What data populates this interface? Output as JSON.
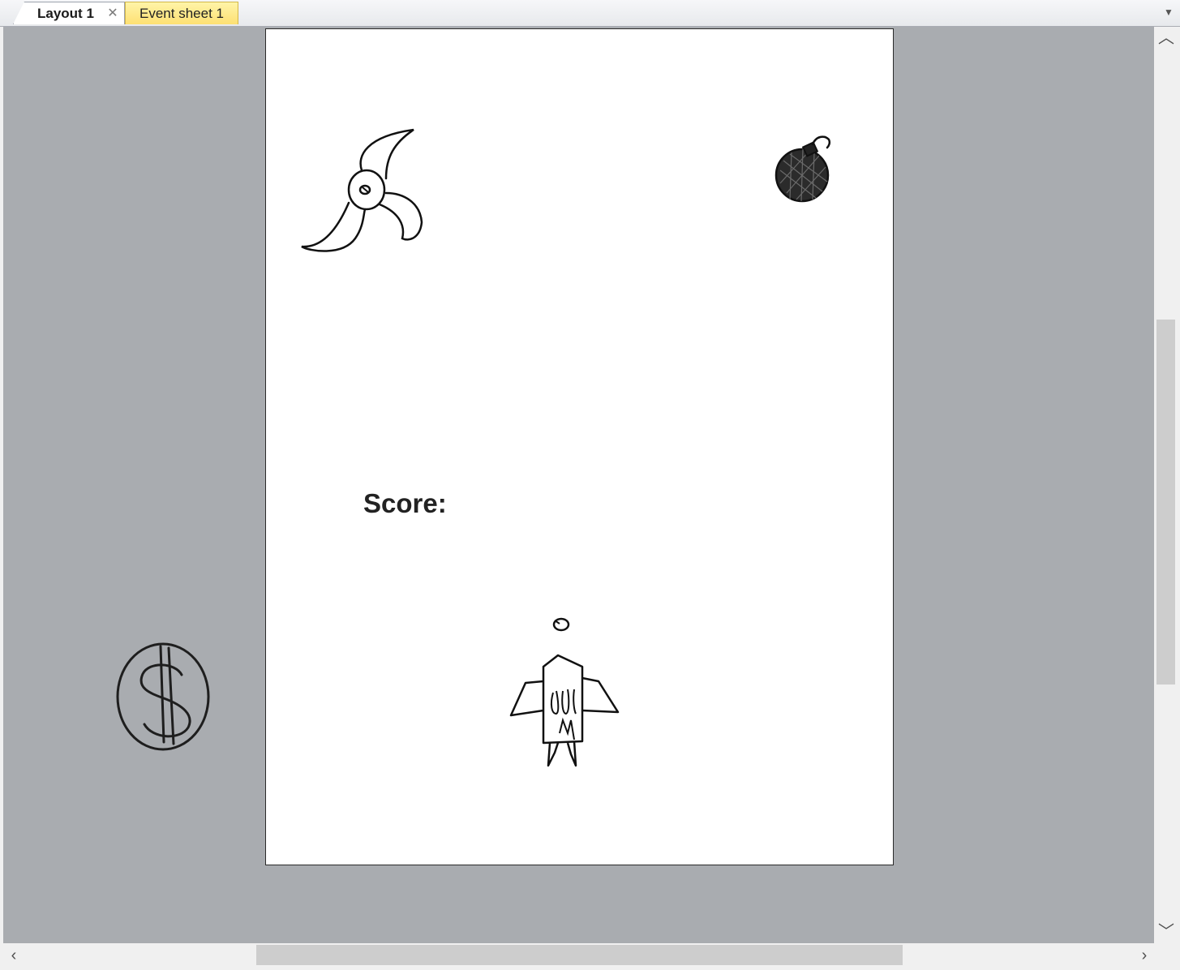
{
  "tabs": [
    {
      "label": "Layout 1",
      "active": true,
      "closable": true,
      "close_icon": "close-icon"
    },
    {
      "label": "Event sheet 1",
      "active": false,
      "accent": "#fde073"
    }
  ],
  "tab_menu_icon": "chevron-down-icon",
  "canvas": {
    "background": "#ffffff",
    "viewport_background": "#a9acb0",
    "score_label": "Score:"
  },
  "sprites": [
    {
      "name": "spinning-blade",
      "icon": "shuriken-icon"
    },
    {
      "name": "bomb",
      "icon": "bomb-icon"
    },
    {
      "name": "coin",
      "icon": "dollar-coin-icon"
    },
    {
      "name": "player-ship",
      "icon": "rocket-icon"
    },
    {
      "name": "bullet",
      "icon": "bullet-icon"
    }
  ],
  "scrollbars": {
    "vertical": {
      "up_icon": "chevron-up-icon",
      "down_icon": "chevron-down-icon"
    },
    "horizontal": {
      "left_icon": "chevron-left-icon",
      "right_icon": "chevron-right-icon"
    }
  }
}
